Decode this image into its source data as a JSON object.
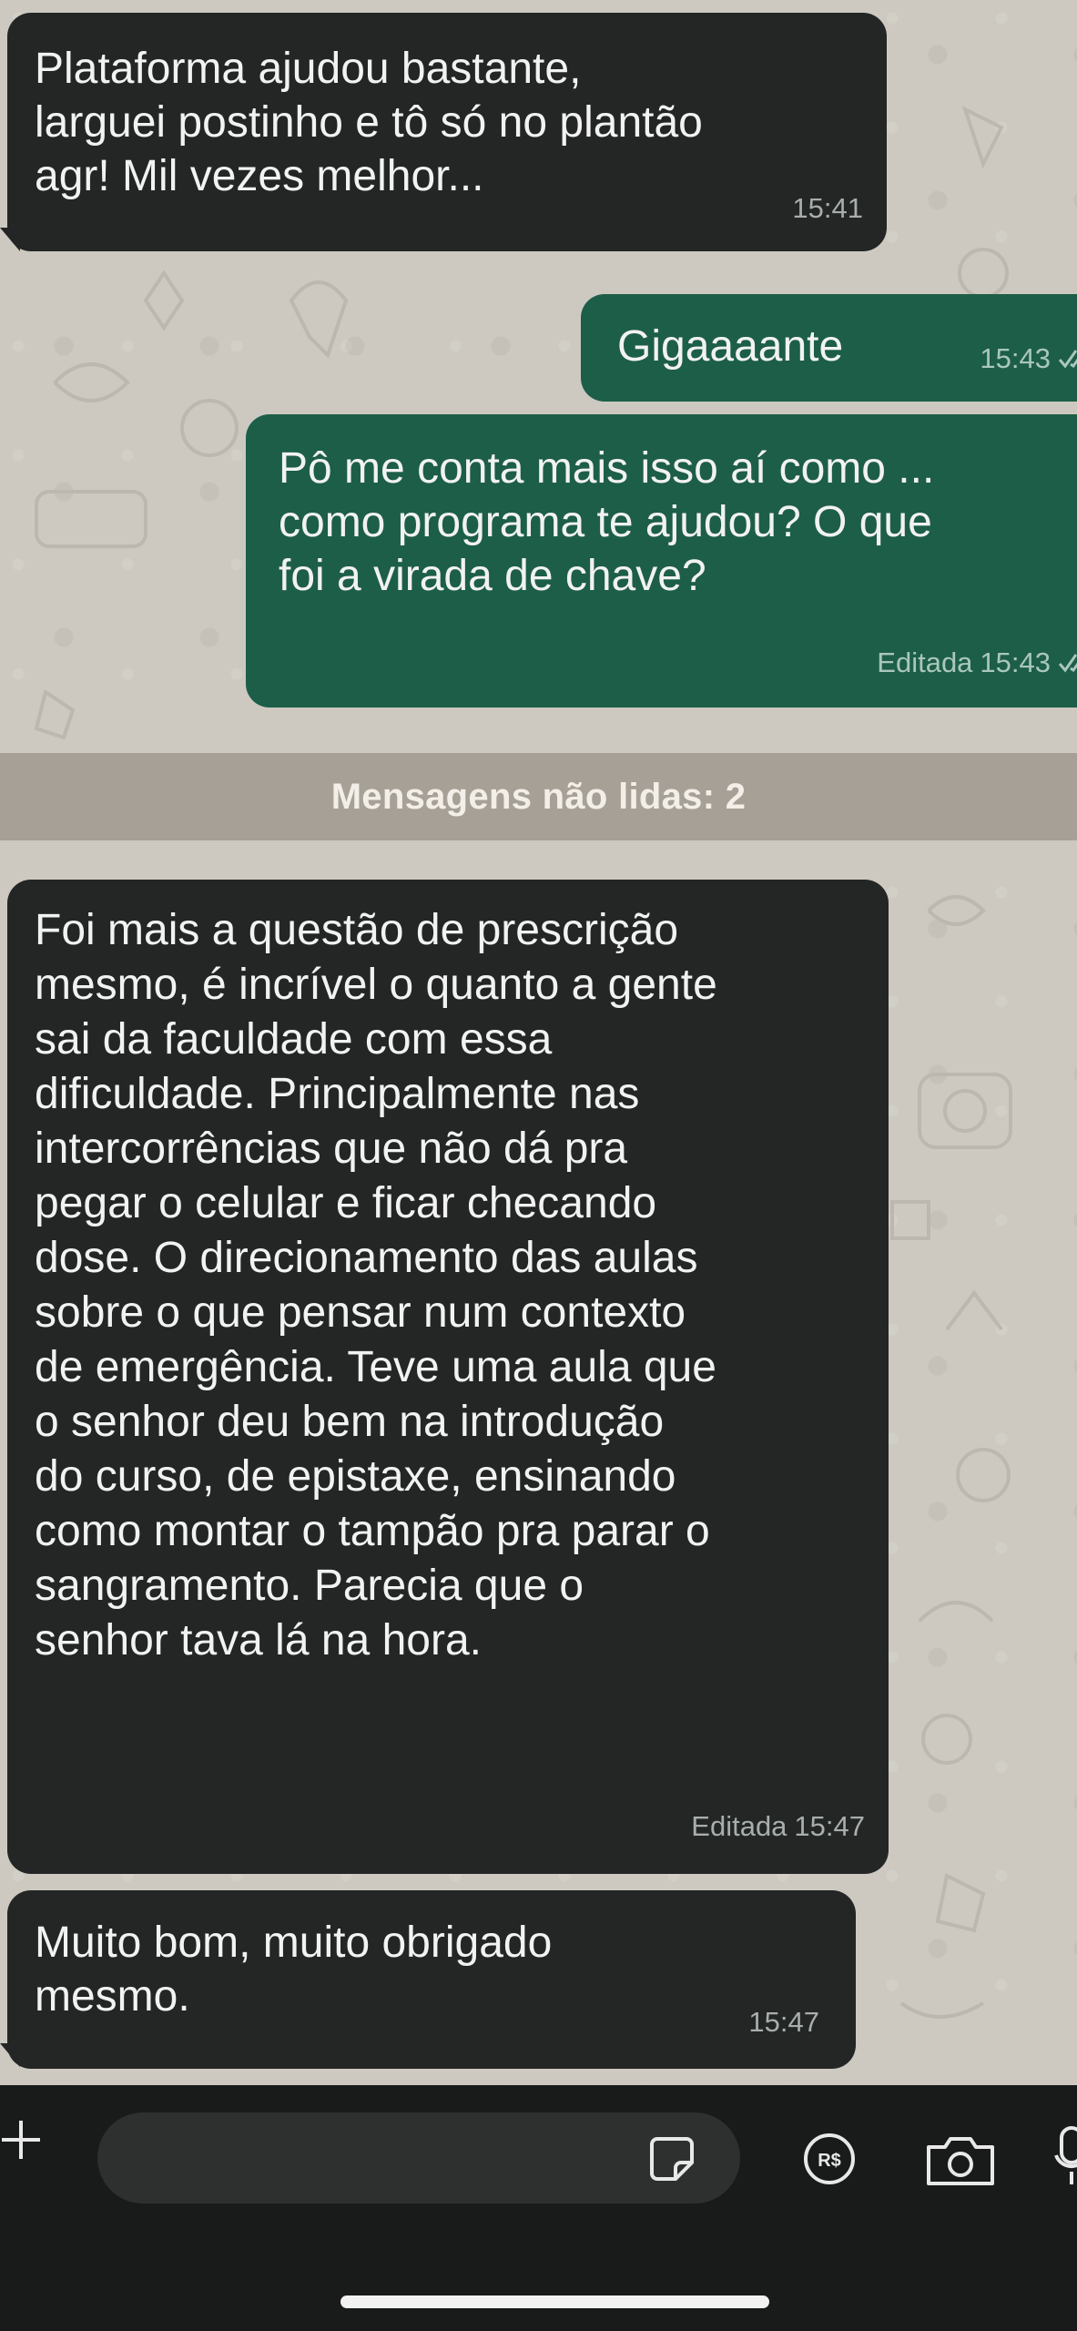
{
  "messages": [
    {
      "direction": "incoming",
      "text": "Plataforma ajudou bastante,\nlarguei postinho e tô só no plantão\nagr! Mil vezes melhor...",
      "edited_label": "",
      "time": "15:41"
    },
    {
      "direction": "outgoing",
      "text": "Gigaaaante",
      "edited_label": "",
      "time": "15:43",
      "status": "read"
    },
    {
      "direction": "outgoing",
      "text": "Pô me conta mais isso aí como ...\ncomo programa te ajudou? O que\nfoi a virada de chave?",
      "edited_label": "Editada",
      "time": "15:43",
      "status": "read"
    },
    {
      "direction": "incoming",
      "text": "Foi mais a questão de prescrição\nmesmo, é incrível o quanto a gente\nsai da faculdade com essa\ndificuldade. Principalmente nas\nintercorrências que não dá pra\npegar o celular e ficar checando\ndose. O direcionamento das aulas\nsobre o que pensar num contexto\nde emergência. Teve uma aula que\no senhor deu bem na introdução\ndo curso, de epistaxe, ensinando\ncomo montar o tampão pra parar o\nsangramento. Parecia que o\nsenhor tava lá na hora.",
      "edited_label": "Editada",
      "time": "15:47"
    },
    {
      "direction": "incoming",
      "text": "Muito bom, muito obrigado\nmesmo.",
      "edited_label": "",
      "time": "15:47"
    }
  ],
  "unread_banner": "Mensagens não lidas: 2",
  "composer": {
    "input_value": "",
    "icons": [
      "plus-icon",
      "sticker-icon",
      "pix-payment-icon",
      "camera-icon",
      "microphone-icon"
    ]
  },
  "colors": {
    "incoming_bubble": "#232625",
    "outgoing_bubble": "#1d5e48",
    "wallpaper": "#cdc9c1",
    "unread_banner": "#a7a096",
    "composer_bar": "#191a1a"
  }
}
